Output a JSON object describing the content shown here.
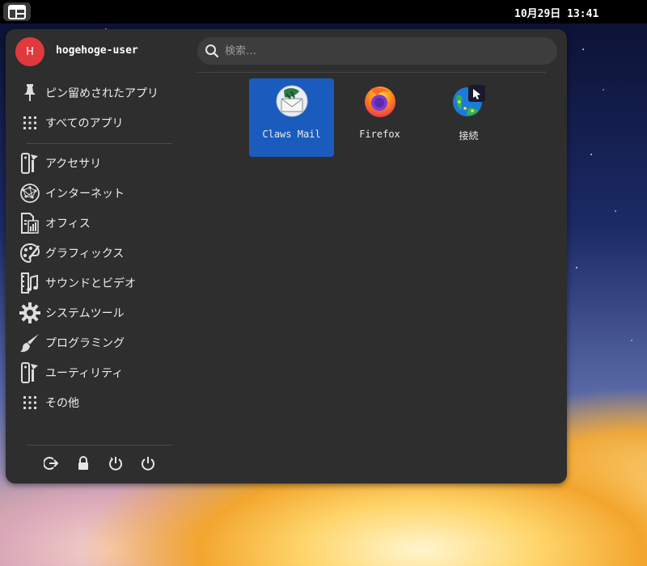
{
  "topbar": {
    "clock": "10月29日 13:41"
  },
  "user": {
    "initial": "H",
    "name": "hogehoge-user"
  },
  "search": {
    "placeholder": "検索…",
    "value": ""
  },
  "sidebar": {
    "items": [
      {
        "label": "ピン留めされたアプリ",
        "icon": "pin-icon"
      },
      {
        "label": "すべてのアプリ",
        "icon": "grid-icon"
      },
      {
        "label": "アクセサリ",
        "icon": "accessories-icon"
      },
      {
        "label": "インターネット",
        "icon": "internet-icon"
      },
      {
        "label": "オフィス",
        "icon": "office-icon"
      },
      {
        "label": "グラフィックス",
        "icon": "graphics-icon"
      },
      {
        "label": "サウンドとビデオ",
        "icon": "multimedia-icon"
      },
      {
        "label": "システムツール",
        "icon": "gear-icon"
      },
      {
        "label": "プログラミング",
        "icon": "brush-icon"
      },
      {
        "label": "ユーティリティ",
        "icon": "utilities-icon"
      },
      {
        "label": "その他",
        "icon": "grid-icon"
      }
    ]
  },
  "power": {
    "buttons": [
      "logout-icon",
      "lock-icon",
      "restart-icon",
      "power-icon"
    ]
  },
  "apps": [
    {
      "label": "Claws Mail",
      "icon": "claws-mail-icon",
      "selected": true
    },
    {
      "label": "Firefox",
      "icon": "firefox-icon",
      "selected": false
    },
    {
      "label": "接続",
      "icon": "connections-icon",
      "selected": false
    }
  ],
  "colors": {
    "accent": "#1a5cbd",
    "avatar": "#e0393e",
    "panel": "#2e2e2e"
  }
}
